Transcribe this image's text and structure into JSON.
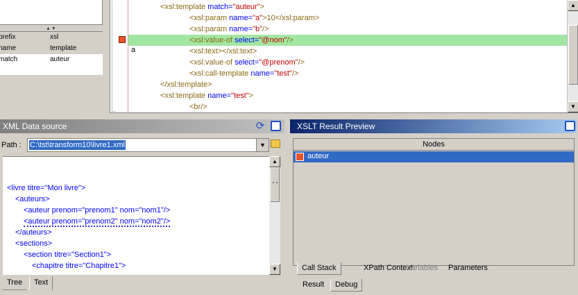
{
  "properties": {
    "rows": [
      {
        "key": "prefix",
        "value": "xsl"
      },
      {
        "key": "name",
        "value": "template"
      },
      {
        "key": "match",
        "value": "auteur"
      }
    ]
  },
  "editor": {
    "lines": [
      {
        "indent": "",
        "tag": "<xsl:template",
        "attr": " match=",
        "val": "\"auteur\"",
        "rest": ">"
      },
      {
        "indent": "          ",
        "tag": "<xsl:param",
        "attr": " name=",
        "val": "\"a\"",
        "rest": ">10</xsl:param>"
      },
      {
        "indent": "          ",
        "tag": "<xsl:param",
        "attr": " name=",
        "val": "\"b\"",
        "rest": "/>"
      },
      {
        "indent": "          ",
        "tag": "<xsl:value-of",
        "attr": " select=",
        "val": "\"@nom\"",
        "rest": "/>"
      },
      {
        "indent": "          ",
        "tag": "<xsl:text>",
        "attr": "",
        "val": "",
        "rest": "</xsl:text>"
      },
      {
        "indent": "          ",
        "tag": "<xsl:value-of",
        "attr": " select=",
        "val": "\"@prenom\"",
        "rest": "/>"
      },
      {
        "indent": "          ",
        "tag": "<xsl:call-template",
        "attr": " name=",
        "val": "\"test\"",
        "rest": "/>"
      },
      {
        "indent": "",
        "tag": "</xsl:template>",
        "attr": "",
        "val": "",
        "rest": ""
      },
      {
        "indent": "",
        "tag": "<xsl:template",
        "attr": " name=",
        "val": "\"test\"",
        "rest": ">"
      },
      {
        "indent": "          ",
        "tag": "<br/>",
        "attr": "",
        "val": "",
        "rest": ""
      }
    ],
    "highlighted_line": 3,
    "variable_marker": "a"
  },
  "xml_source": {
    "title": "XML Data source",
    "path_label": "Path :",
    "path_value": "C:\\tst\\transform10\\livre1.xml",
    "lines": [
      {
        "text": "<livre titre=\"Mon livre\">",
        "indent": 0
      },
      {
        "text": "<auteurs>",
        "indent": 1
      },
      {
        "text": "<auteur prenom=\"prenom1\" nom=\"nom1\"/>",
        "indent": 2
      },
      {
        "text": "<auteur prenom=\"prenom2\" nom=\"nom2\"/>",
        "indent": 2
      },
      {
        "text": "</auteurs>",
        "indent": 1
      },
      {
        "text": "<sections>",
        "indent": 1
      },
      {
        "text": "<section titre=\"Section1\">",
        "indent": 2
      },
      {
        "text": "<chapitre titre=\"Chapitre1\">",
        "indent": 3
      }
    ],
    "tabs": [
      "Tree",
      "Text"
    ],
    "active_tab": "Text"
  },
  "xslt_preview": {
    "title": "XSLT Result Preview",
    "column_header": "Nodes",
    "nodes": [
      "auteur"
    ],
    "debug_tabs": [
      {
        "label": "Call Stack",
        "disabled": false
      },
      {
        "label": "XPath Context",
        "disabled": false
      },
      {
        "label": "Variables",
        "disabled": true
      },
      {
        "label": "Parameters",
        "disabled": false
      }
    ],
    "bottom_tabs": [
      "Result",
      "Debug"
    ],
    "active_bottom_tab": "Debug",
    "active_debug_tab": "Call Stack"
  },
  "colors": {
    "highlight_line": "#a3e6a3",
    "selection": "#316ac5",
    "active_title": "#0a246a",
    "inactive_title": "#808080"
  }
}
